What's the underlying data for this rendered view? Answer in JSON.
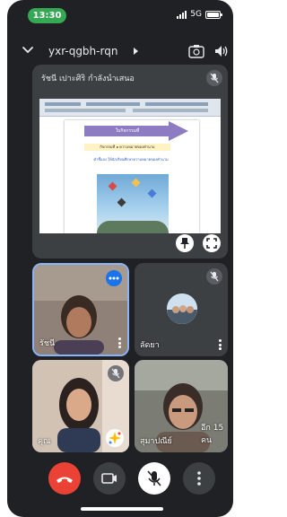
{
  "status_bar": {
    "time": "13:30",
    "network": "5G"
  },
  "meeting": {
    "code": "yxr-qgbh-rqn"
  },
  "presentation": {
    "presenter_label": "รัชนี เปาะศิริ กำลังนำเสนอ",
    "slide_title": "ใบกิจกรรมที่",
    "slide_subtitle": "กิจกรรมที่ ๑ ความหมายของคำนาม",
    "slide_line": "คำชี้แจง ให้นักเรียนศึกษาความหมายของคำนาม"
  },
  "participants": [
    {
      "name": "รัชนี",
      "speaking": true
    },
    {
      "name": "ลัดยา",
      "avatar": true
    },
    {
      "name": "คุณ"
    },
    {
      "name": "สุมาปณีย์",
      "more_label": "อีก 15 คน"
    }
  ],
  "colors": {
    "accent": "#8ab4f8",
    "end_call": "#ea4335",
    "time_pill": "#34a853"
  }
}
